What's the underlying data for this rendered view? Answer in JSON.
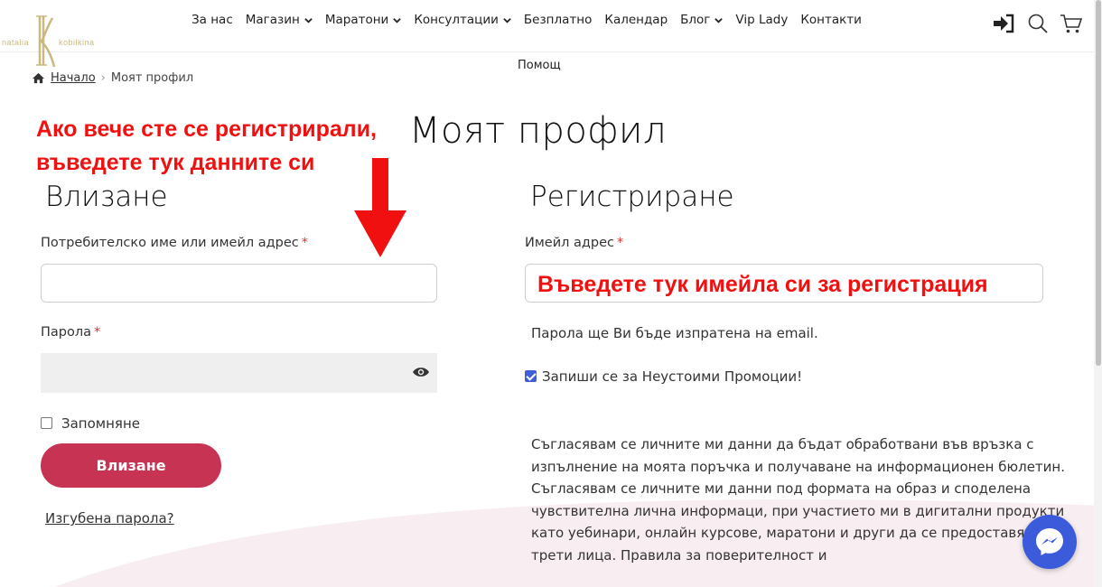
{
  "header": {
    "logo_left": "natalia",
    "logo_right": "kobilkina",
    "nav": [
      {
        "label": "За нас",
        "dropdown": false
      },
      {
        "label": "Магазин",
        "dropdown": true
      },
      {
        "label": "Маратони",
        "dropdown": true
      },
      {
        "label": "Консултации",
        "dropdown": true
      },
      {
        "label": "Безплатно",
        "dropdown": false
      },
      {
        "label": "Календар",
        "dropdown": false
      },
      {
        "label": "Блог",
        "dropdown": true
      },
      {
        "label": "Vip Lady",
        "dropdown": false
      },
      {
        "label": "Контакти",
        "dropdown": false
      }
    ],
    "help": "Помощ",
    "icons": [
      "sign-in-icon",
      "search-icon",
      "cart-icon"
    ]
  },
  "breadcrumb": {
    "home": "Начало",
    "separator": "›",
    "current": "Моят профил"
  },
  "annotations": {
    "line1": "Ако вече сте се регистрирали,",
    "line2": "въведете тук данните си",
    "email": "Въведете тук имейла си за регистрация"
  },
  "page_title": "Моят профил",
  "login": {
    "heading": "Влизане",
    "username_label": "Потребителско име или имейл адрес",
    "password_label": "Парола",
    "required_mark": "*",
    "remember_label": "Запомняне",
    "submit_label": "Влизане",
    "lost_password": "Изгубена парола?"
  },
  "register": {
    "heading": "Регистриране",
    "email_label": "Имейл адрес",
    "required_mark": "*",
    "password_info": "Парола ще Ви бъде изпратена на email.",
    "promo_label": "Запиши се за Неустоими Промоции!",
    "promo_checked": true,
    "consent": "Съгласявам се личните ми данни да бъдат обработвани във връзка с изпълнение на моята поръчка и получаване на информационен бюлетин. Съгласявам се личните ми данни под формата на образ и споделена чувствителна лична информаци, при участието ми в дигитални продукти като уебинари, онлайн курсове, маратони и други да се предоставят на трети лица. Правила за поверителност и"
  },
  "colors": {
    "accent": "#c73352",
    "annotation": "#f01010",
    "messenger": "#3b5bdb",
    "logo_gold": "#c9b980"
  }
}
